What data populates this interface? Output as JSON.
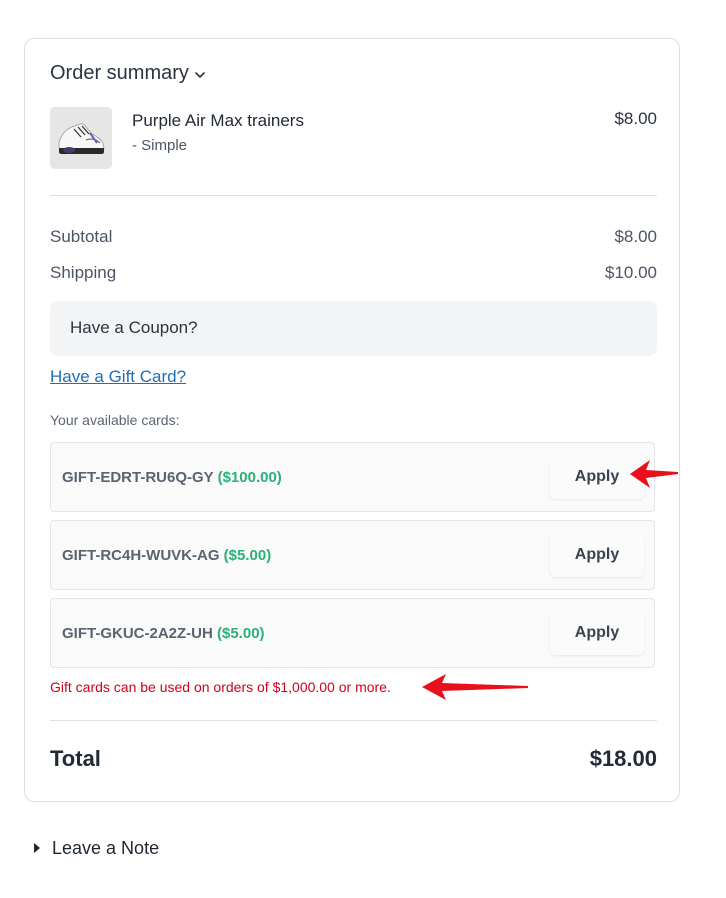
{
  "order_summary": {
    "title": "Order summary",
    "toggle_icon": "chevron-down-icon"
  },
  "product": {
    "name": "Purple Air Max trainers",
    "variant": "- Simple",
    "price": "$8.00",
    "image": "sneaker-thumbnail"
  },
  "totals": {
    "subtotal_label": "Subtotal",
    "subtotal_value": "$8.00",
    "shipping_label": "Shipping",
    "shipping_value": "$10.00",
    "total_label": "Total",
    "total_value": "$18.00"
  },
  "coupon": {
    "label": "Have a Coupon?"
  },
  "gift": {
    "link_label": "Have a Gift Card?",
    "available_label": "Your available cards:",
    "cards": [
      {
        "code": "GIFT-EDRT-RU6Q-GY",
        "amount": "($100.00)",
        "button": "Apply"
      },
      {
        "code": "GIFT-RC4H-WUVK-AG",
        "amount": "($5.00)",
        "button": "Apply"
      },
      {
        "code": "GIFT-GKUC-2A2Z-UH",
        "amount": "($5.00)",
        "button": "Apply"
      }
    ],
    "notice": "Gift cards can be used on orders of $1,000.00 or more."
  },
  "note": {
    "label": "Leave a Note",
    "icon": "caret-right-icon"
  },
  "colors": {
    "link": "#1d6fb8",
    "amount_green": "#2bb07a",
    "error_red": "#d0021b",
    "annotation_arrow": "#e8101a"
  }
}
